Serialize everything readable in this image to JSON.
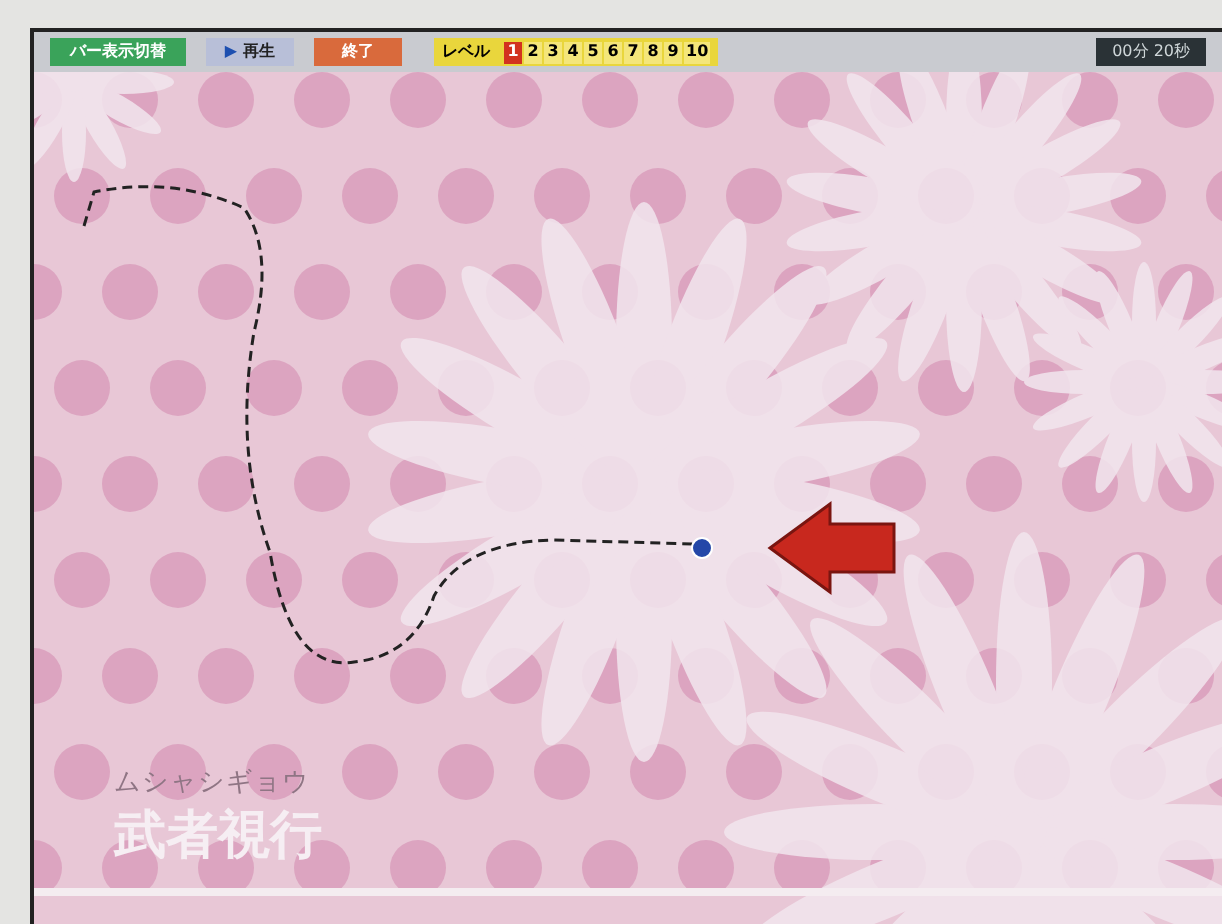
{
  "toolbar": {
    "toggle_button": "バー表示切替",
    "play_button": {
      "icon": "▶",
      "label": "再生"
    },
    "end_button": "終了",
    "level_label": "レベル",
    "levels": [
      {
        "label": "1",
        "selected": true
      },
      {
        "label": "2",
        "selected": false
      },
      {
        "label": "3",
        "selected": false
      },
      {
        "label": "4",
        "selected": false
      },
      {
        "label": "5",
        "selected": false
      },
      {
        "label": "6",
        "selected": false
      },
      {
        "label": "7",
        "selected": false
      },
      {
        "label": "8",
        "selected": false
      },
      {
        "label": "9",
        "selected": false
      },
      {
        "label": "10",
        "selected": false
      }
    ],
    "timer": "00分 20秒"
  },
  "game": {
    "subtitle": "ムシャシギョウ",
    "title": "武者視行"
  }
}
